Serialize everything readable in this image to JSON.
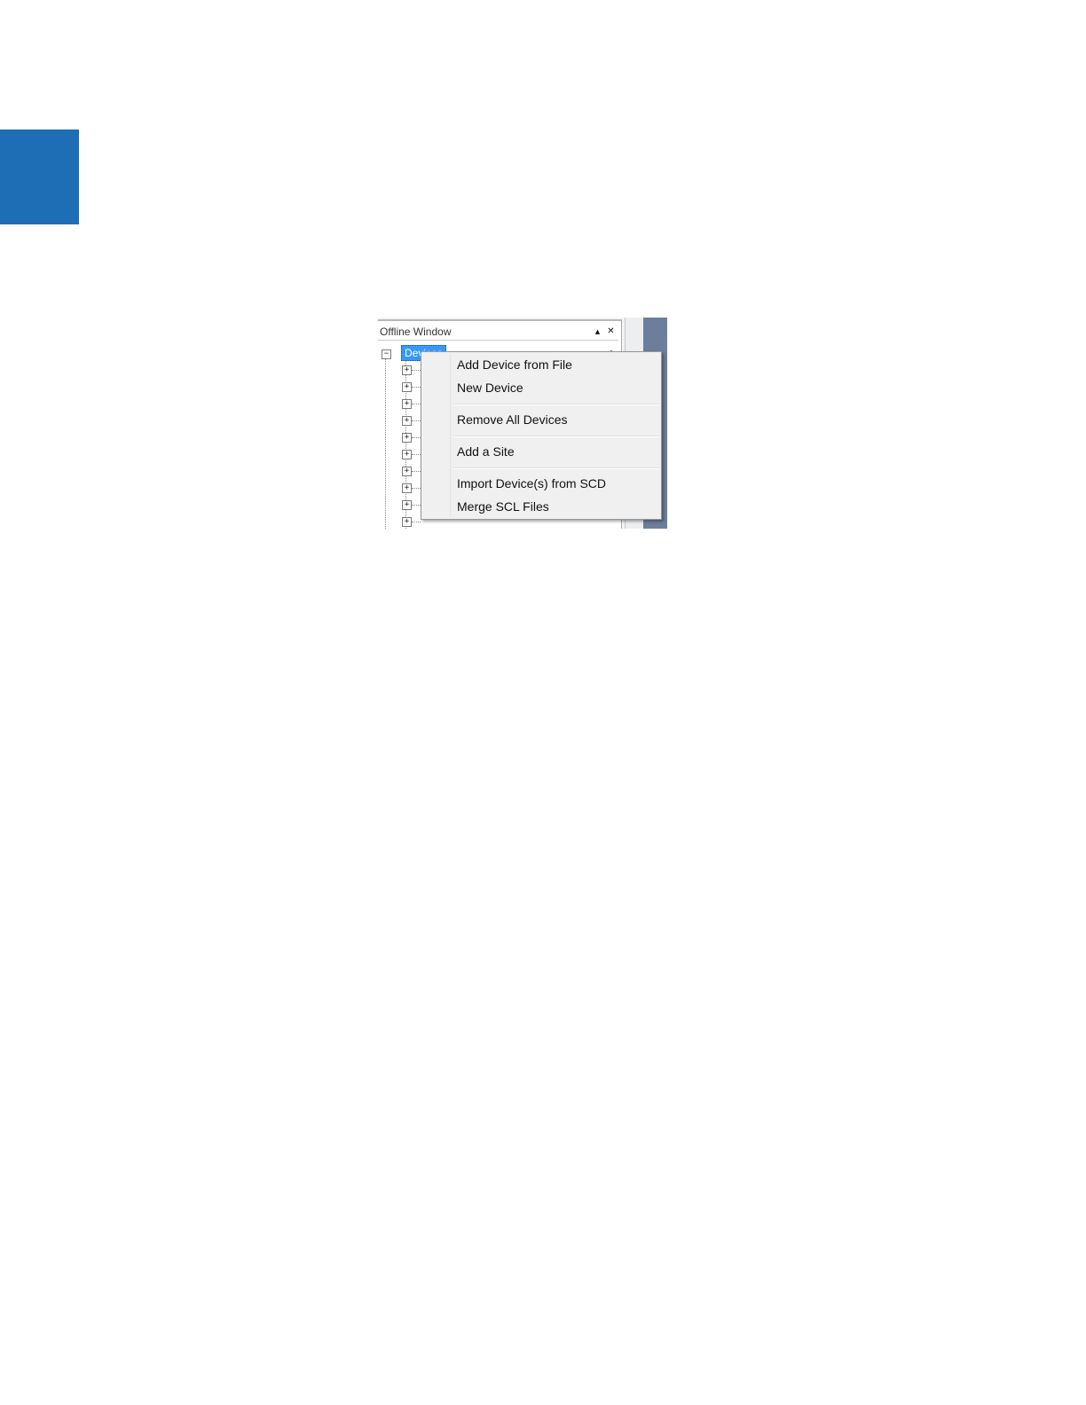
{
  "side_tab": {
    "color": "#1e6eb6"
  },
  "panel": {
    "title": "Offline Window",
    "pin_icon": "pin-up-arrow-icon",
    "close_icon": "close-icon",
    "pin_glyph": "▲",
    "close_glyph": "✕"
  },
  "tree": {
    "root_label": "Devices",
    "root_expander": "−",
    "child_expander": "+",
    "selected_color": "#3399ff",
    "scroll_glyph": "▲"
  },
  "context_menu": {
    "items": [
      {
        "label": "Add Device from File"
      },
      {
        "label": "New Device"
      },
      {
        "label": "Remove All Devices"
      },
      {
        "label": "Add a Site"
      },
      {
        "label": "Import Device(s) from SCD"
      },
      {
        "label": "Merge SCL Files"
      }
    ]
  }
}
